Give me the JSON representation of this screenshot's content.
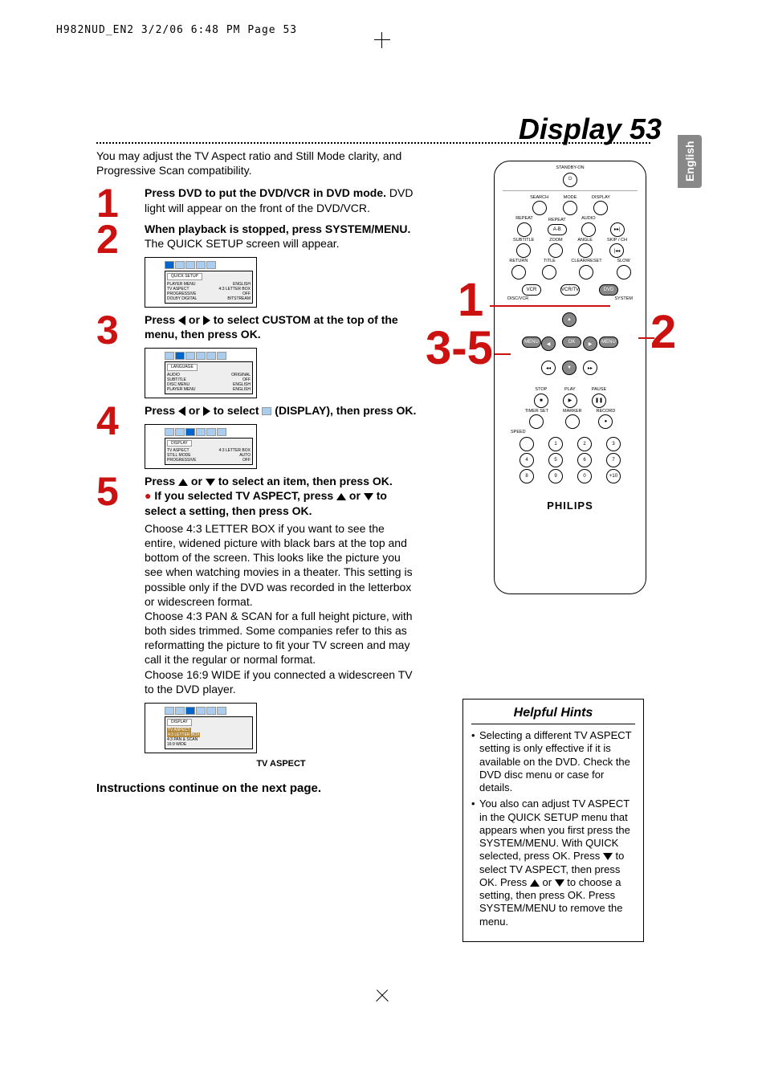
{
  "header_info": "H982NUD_EN2  3/2/06  6:48 PM  Page 53",
  "page_title": "Display  53",
  "lang_tab": "English",
  "intro": "You may adjust the TV Aspect ratio and Still Mode clarity, and Progressive Scan compatibility.",
  "steps": {
    "s1": {
      "num": "1",
      "bold": "Press DVD to put the DVD/VCR in DVD mode.",
      "rest": " DVD light will appear on the front of the DVD/VCR."
    },
    "s2": {
      "num": "2",
      "bold_a": "When playback is stopped, press SYSTEM/MENU.",
      "rest": " The QUICK SETUP screen will appear."
    },
    "s3": {
      "num": "3",
      "pre": "Press ",
      "mid": " or ",
      "post": " to select CUSTOM at the top of the menu, then press OK."
    },
    "s4": {
      "num": "4",
      "pre": "Press ",
      "mid": " or ",
      "mid2": " to select ",
      "post": " (DISPLAY), then press OK."
    },
    "s5": {
      "num": "5",
      "line1_pre": "Press ",
      "line1_mid": " or ",
      "line1_post": " to select an item, then press OK.",
      "bullet_pre": "If you selected TV ASPECT, press ",
      "bullet_mid": " or ",
      "bullet_post": " to select a setting, then press OK.",
      "para": "Choose 4:3 LETTER BOX if you want to see the entire, widened picture with black bars at the top and bottom of the screen. This looks like the picture you see when watching movies in a theater.  This setting is possible only if the DVD was recorded in the letterbox or widescreen format.\nChoose 4:3 PAN & SCAN for a full height picture, with both sides trimmed. Some companies refer to this as reformatting the picture to fit your TV screen and may call it the regular or normal format.\nChoose 16:9 WIDE if you connected a widescreen TV to the DVD player."
    }
  },
  "osd1": {
    "header": "QUICK SETUP",
    "rows": [
      [
        "PLAYER MENU",
        "ENGLISH"
      ],
      [
        "TV ASPECT",
        "4:3 LETTER BOX"
      ],
      [
        "PROGRESSIVE",
        "OFF"
      ],
      [
        "DOLBY DIGITAL",
        "BITSTREAM"
      ]
    ]
  },
  "osd2": {
    "header": "LANGUAGE",
    "rows": [
      [
        "AUDIO",
        "ORIGINAL"
      ],
      [
        "SUBTITLE",
        "OFF"
      ],
      [
        "DISC MENU",
        "ENGLISH"
      ],
      [
        "PLAYER MENU",
        "ENGLISH"
      ]
    ]
  },
  "osd3": {
    "header": "DISPLAY",
    "rows": [
      [
        "TV ASPECT",
        "4:3 LETTER BOX"
      ],
      [
        "STILL MODE",
        "AUTO"
      ],
      [
        "PROGRESSIVE",
        "OFF"
      ]
    ]
  },
  "osd4": {
    "header": "DISPLAY",
    "sub": "TV ASPECT",
    "rows": [
      [
        "4:3 LETTER BOX",
        ""
      ],
      [
        "4:3 PAN & SCAN",
        ""
      ],
      [
        "16:9 WIDE",
        ""
      ]
    ],
    "caption": "TV ASPECT"
  },
  "continue": "Instructions continue on the next page.",
  "remote": {
    "standby": "STANDBY-ON",
    "r1": [
      "SEARCH",
      "MODE",
      "DISPLAY"
    ],
    "r2": [
      "REPEAT",
      "REPEAT",
      "AUDIO"
    ],
    "ab": "A-B",
    "r3": [
      "SUBTITLE",
      "ZOOM",
      "ANGLE",
      "SKIP / CH"
    ],
    "r4": [
      "RETURN",
      "TITLE",
      "CLEAR/RESET",
      "SLOW"
    ],
    "vcr": "VCR",
    "vcrtv": "VCR/TV",
    "dvd": "DVD",
    "discvcr": "DISC/VCR",
    "system": "SYSTEM",
    "menu_l": "MENU",
    "menu_r": "MENU",
    "ok": "OK",
    "stop": "STOP",
    "play": "PLAY",
    "pause": "PAUSE",
    "timer": "TIMER SET",
    "marker": "MARKER",
    "record": "RECORD",
    "speed": "SPEED",
    "nums": [
      "1",
      "2",
      "3",
      "4",
      "5",
      "6",
      "7",
      "8",
      "9",
      "0",
      "+10"
    ],
    "brand": "PHILIPS"
  },
  "callouts": {
    "c1": "1",
    "c2": "2",
    "c35": "3-5"
  },
  "hints": {
    "title": "Helpful Hints",
    "h1": "Selecting a different TV ASPECT setting is only effective if it is available on the DVD. Check the DVD disc menu or case for details.",
    "h2_a": "You also can adjust TV ASPECT in the QUICK SETUP menu that appears when you first press the SYSTEM/MENU. With QUICK selected, press OK. Press ",
    "h2_b": " to select TV ASPECT, then press OK. Press ",
    "h2_c": " or ",
    "h2_d": " to choose a setting, then press OK. Press SYSTEM/MENU to remove the menu."
  }
}
